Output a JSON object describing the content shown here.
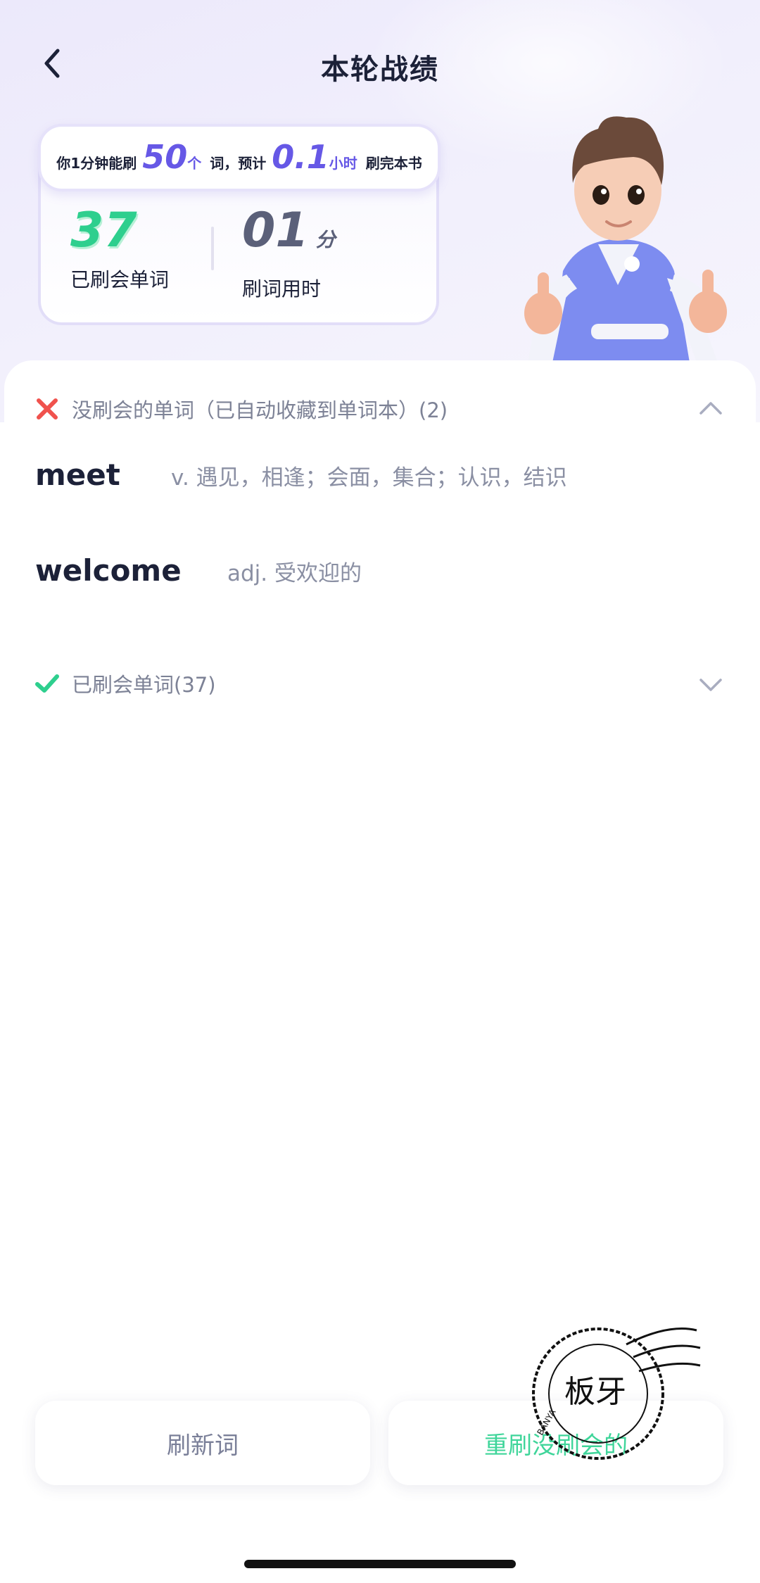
{
  "header": {
    "title": "本轮战绩",
    "back_icon": "back-arrow-icon"
  },
  "speed_banner": {
    "prefix": "你1分钟能刷",
    "words_per_minute": "50",
    "words_unit": "个",
    "middle": "词，预计",
    "hours": "0.1",
    "hours_unit": "小时",
    "suffix": "刷完本书"
  },
  "stats": {
    "learned_count": "37",
    "learned_label": "已刷会单词",
    "time_value": "01",
    "time_unit": "分",
    "time_label": "刷词用时"
  },
  "unlearned_section": {
    "title": "没刷会的单词（已自动收藏到单词本）(2)",
    "icon": "x-mark-icon",
    "status_color": "#f0524d",
    "expanded": true,
    "words": [
      {
        "word": "meet",
        "meaning": "v. 遇见，相逢；会面，集合；认识，结识"
      },
      {
        "word": "welcome",
        "meaning": "adj. 受欢迎的"
      }
    ]
  },
  "learned_section": {
    "title": "已刷会单词(37)",
    "icon": "checkmark-icon",
    "status_color": "#2ecf8e",
    "expanded": false
  },
  "buttons": {
    "refresh_label": "刷新词",
    "retry_label": "重刷没刷会的"
  },
  "watermark": {
    "text": "板牙",
    "ring_text": "BANYA"
  },
  "colors": {
    "accent": "#6658e6",
    "success": "#2ecf8e",
    "error": "#f0524d"
  }
}
